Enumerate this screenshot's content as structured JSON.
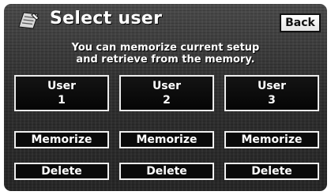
{
  "header": {
    "title": "Select user",
    "icon": "user-memory-icon",
    "back_label": "Back"
  },
  "info": {
    "line1": "You can memorize current setup",
    "line2": "and retrieve from the memory."
  },
  "users": [
    {
      "label": "User",
      "number": "1",
      "memorize_label": "Memorize",
      "delete_label": "Delete"
    },
    {
      "label": "User",
      "number": "2",
      "memorize_label": "Memorize",
      "delete_label": "Delete"
    },
    {
      "label": "User",
      "number": "3",
      "memorize_label": "Memorize",
      "delete_label": "Delete"
    }
  ],
  "colors": {
    "background": "#303030",
    "text": "#ffffff",
    "button_fill": "#0a0a0a",
    "button_border": "#ececec",
    "back_fill": "#ffffff"
  }
}
